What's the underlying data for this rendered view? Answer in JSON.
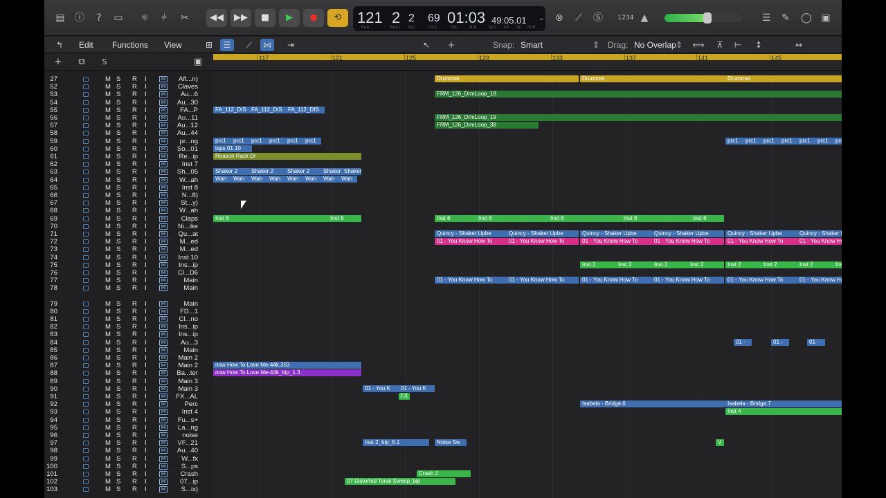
{
  "transport": {
    "bar": "121",
    "beat": "2",
    "div": "2",
    "tick": "69",
    "time": "01:03",
    "time_sub": "49:05.01",
    "cap_bar": "BAR",
    "cap_beat": "BEAT",
    "cap_div": "DIV",
    "cap_tick": "TICK",
    "cap_hr": "HR",
    "cap_min": "MIN",
    "cap_sec": "SEC",
    "cap_fr": "FR",
    "cap_sf": "SF",
    "cap_sub": "SUB",
    "count_in": "1234"
  },
  "menus": {
    "edit": "Edit",
    "functions": "Functions",
    "view": "View"
  },
  "snap": {
    "label": "Snap:",
    "value": "Smart"
  },
  "drag": {
    "label": "Drag:",
    "value": "No Overlap"
  },
  "track_header": {
    "add": "+",
    "s": "S"
  },
  "ruler": {
    "marks": [
      "117",
      "121",
      "125",
      "129",
      "133",
      "137",
      "141",
      "145"
    ]
  },
  "tracks": [
    {
      "n": "27",
      "name": "Aft...n)"
    },
    {
      "n": "52",
      "name": "Claves"
    },
    {
      "n": "53",
      "name": "Au...6"
    },
    {
      "n": "54",
      "name": "Au...30"
    },
    {
      "n": "55",
      "name": "FA...P"
    },
    {
      "n": "56",
      "name": "Au...11"
    },
    {
      "n": "57",
      "name": "Au...12"
    },
    {
      "n": "58",
      "name": "Au...44"
    },
    {
      "n": "59",
      "name": "pr...ng"
    },
    {
      "n": "60",
      "name": "So...01"
    },
    {
      "n": "61",
      "name": "Re...ip"
    },
    {
      "n": "62",
      "name": "Inst 7"
    },
    {
      "n": "63",
      "name": "Sh...05"
    },
    {
      "n": "64",
      "name": "W...ah"
    },
    {
      "n": "65",
      "name": "Inst 8"
    },
    {
      "n": "66",
      "name": "N...8)"
    },
    {
      "n": "67",
      "name": "St...y)"
    },
    {
      "n": "68",
      "name": "W...ah"
    },
    {
      "n": "69",
      "name": "Claps"
    },
    {
      "n": "70",
      "name": "Ni...ike"
    },
    {
      "n": "71",
      "name": "Qu...at"
    },
    {
      "n": "72",
      "name": "M...ed"
    },
    {
      "n": "73",
      "name": "M...ed"
    },
    {
      "n": "74",
      "name": "Inst 10"
    },
    {
      "n": "75",
      "name": "Ins...ip"
    },
    {
      "n": "76",
      "name": "Cl...D6"
    },
    {
      "n": "77",
      "name": "Main"
    },
    {
      "n": "78",
      "name": "Main"
    },
    {
      "n": "79",
      "name": "Main"
    },
    {
      "n": "80",
      "name": "FD...1"
    },
    {
      "n": "81",
      "name": "Cl...no"
    },
    {
      "n": "82",
      "name": "Ins...ip"
    },
    {
      "n": "83",
      "name": "Ins...ip"
    },
    {
      "n": "84",
      "name": "Au...3"
    },
    {
      "n": "85",
      "name": "Main"
    },
    {
      "n": "86",
      "name": "Main 2"
    },
    {
      "n": "87",
      "name": "Main 2"
    },
    {
      "n": "88",
      "name": "Ba...ter"
    },
    {
      "n": "89",
      "name": "Main 3"
    },
    {
      "n": "90",
      "name": "Main 3"
    },
    {
      "n": "91",
      "name": "FX...AL"
    },
    {
      "n": "92",
      "name": "Perc"
    },
    {
      "n": "93",
      "name": "Inst 4"
    },
    {
      "n": "94",
      "name": "Fu...s+"
    },
    {
      "n": "95",
      "name": "La...ng"
    },
    {
      "n": "96",
      "name": "noise"
    },
    {
      "n": "97",
      "name": "VF...21"
    },
    {
      "n": "98",
      "name": "Au...40"
    },
    {
      "n": "99",
      "name": "W...fx"
    },
    {
      "n": "100",
      "name": "S...ps"
    },
    {
      "n": "101",
      "name": "Crash"
    },
    {
      "n": "102",
      "name": "07...ip"
    },
    {
      "n": "103",
      "name": "S...ix)"
    }
  ],
  "regions": {
    "drummer": "Drummer",
    "drm18": "FRM_126_DrmLoop_18",
    "drm19": "FRM_126_DrmLoop_19",
    "drm38": "FRM_126_DrmLoop_38",
    "fa": "FA_112_DIS",
    "prc": "prc1",
    "claps": "laps 01.10",
    "reason": "Reason Rack Dr",
    "shaker": "Shaker 2",
    "wah": "Wah",
    "inst6": "Inst 6",
    "quincy": "Quincy - Shaker Upbe",
    "youknow": "01 - You Know How To",
    "inst2": "Inst 2",
    "youknow_short": "01 -",
    "love1": "now How To Love Me-44k.353",
    "love2": "now How To Love Me-44k_bip_1.3",
    "youk": "01 - You K",
    "fx": "FX",
    "bridge6": "Isabela - Bridge.6",
    "bridge7": "Isabela - Bridge.7",
    "inst4": "Inst 4",
    "inst2bip": "Inst 2_bip_6.1",
    "noise": "Noise Sw",
    "v": "V",
    "crash": "Crash.1",
    "distorted": "07 Distorted Tonal Sweep_bip"
  }
}
